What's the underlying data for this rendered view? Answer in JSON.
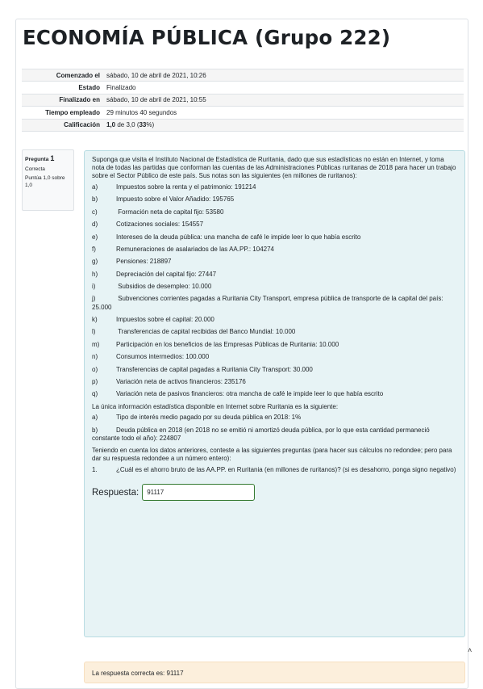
{
  "page": {
    "title": "ECONOMÍA PÚBLICA (Grupo 222)"
  },
  "summary": [
    {
      "label": "Comenzado el",
      "value": "sábado, 10 de abril de 2021, 10:26"
    },
    {
      "label": "Estado",
      "value": "Finalizado"
    },
    {
      "label": "Finalizado en",
      "value": "sábado, 10 de abril de 2021, 10:55"
    },
    {
      "label": "Tiempo empleado",
      "value": "29 minutos 40 segundos"
    },
    {
      "label": "Calificación",
      "value_bold": "1,0",
      "value_mid": " de 3,0 (",
      "value_pct": "33",
      "value_end": "%)"
    }
  ],
  "question": {
    "label": "Pregunta",
    "number": "1",
    "state": "Correcta",
    "grade": "Puntúa 1,0 sobre 1,0",
    "intro": "Suponga que visita el Instituto Nacional de Estadística de Ruritania, dado que sus estadísticas no están en Internet, y toma nota de todas las partidas que conforman las cuentas de las Administraciones Públicas ruritanas de 2018 para hacer un trabajo sobre el Sector Público de este país. Sus notas son las siguientes (en millones de ruritanos):",
    "items": [
      {
        "lbl": "a)",
        "text": "Impuestos sobre la renta y el patrimonio: 191214"
      },
      {
        "lbl": "b)",
        "text": "Impuesto sobre el Valor Añadido: 195765"
      },
      {
        "lbl": "c)",
        "text": " Formación neta de capital fijo: 53580"
      },
      {
        "lbl": "d)",
        "text": "Cotizaciones sociales: 154557"
      },
      {
        "lbl": "e)",
        "text": "Intereses de la deuda pública: una mancha de café le impide leer lo que había escrito"
      },
      {
        "lbl": "f)",
        "text": "Remuneraciones de asalariados de las AA.PP.: 104274"
      },
      {
        "lbl": "g)",
        "text": "Pensiones: 218897"
      },
      {
        "lbl": "h)",
        "text": "Depreciación del capital fijo: 27447"
      },
      {
        "lbl": "i)",
        "text": " Subsidios de desempleo: 10.000"
      },
      {
        "lbl": "j)",
        "text": " Subvenciones corrientes pagadas a Ruritania City Transport, empresa pública de transporte de la capital del país: 25.000"
      },
      {
        "lbl": "k)",
        "text": "Impuestos sobre el capital: 20.000"
      },
      {
        "lbl": "l)",
        "text": " Transferencias de capital recibidas del Banco Mundial: 10.000"
      },
      {
        "lbl": "m)",
        "text": "Participación en los beneficios de las Empresas Públicas de Ruritania: 10.000"
      },
      {
        "lbl": "n)",
        "text": "Consumos intermedios: 100.000"
      },
      {
        "lbl": "o)",
        "text": "Transferencias de capital pagadas a Ruritania City Transport: 30.000"
      },
      {
        "lbl": "p)",
        "text": "Variación neta de activos financieros: 235176"
      },
      {
        "lbl": "q)",
        "text": "Variación neta de pasivos financieros: otra mancha de café le impide leer lo que había escrito"
      }
    ],
    "internet_intro": "La única información estadística disponible en Internet sobre Ruritania es la siguiente:",
    "internet_items": [
      {
        "lbl": "a)",
        "text": "Tipo de interés medio pagado por su deuda pública en 2018: 1%"
      },
      {
        "lbl": "b)",
        "text": "Deuda pública en 2018 (en 2018 no se emitió ni amortizó deuda pública, por lo que esta cantidad permaneció constante todo el año): 224807"
      }
    ],
    "instructions": "Teniendo en cuenta los datos anteriores, conteste a las siguientes preguntas (para hacer sus cálculos no redondee; pero para dar su respuesta redondee a un número entero):",
    "prompt_lbl": "1.",
    "prompt": "¿Cuál es el ahorro bruto de las AA.PP. en Ruritania (en millones de ruritanos)? (si es desahorro, ponga signo negativo)",
    "answer_label": "Respuesta:",
    "answer_value": "91117",
    "feedback": "La respuesta correcta es: 91117",
    "collapse_glyph": "˄"
  }
}
